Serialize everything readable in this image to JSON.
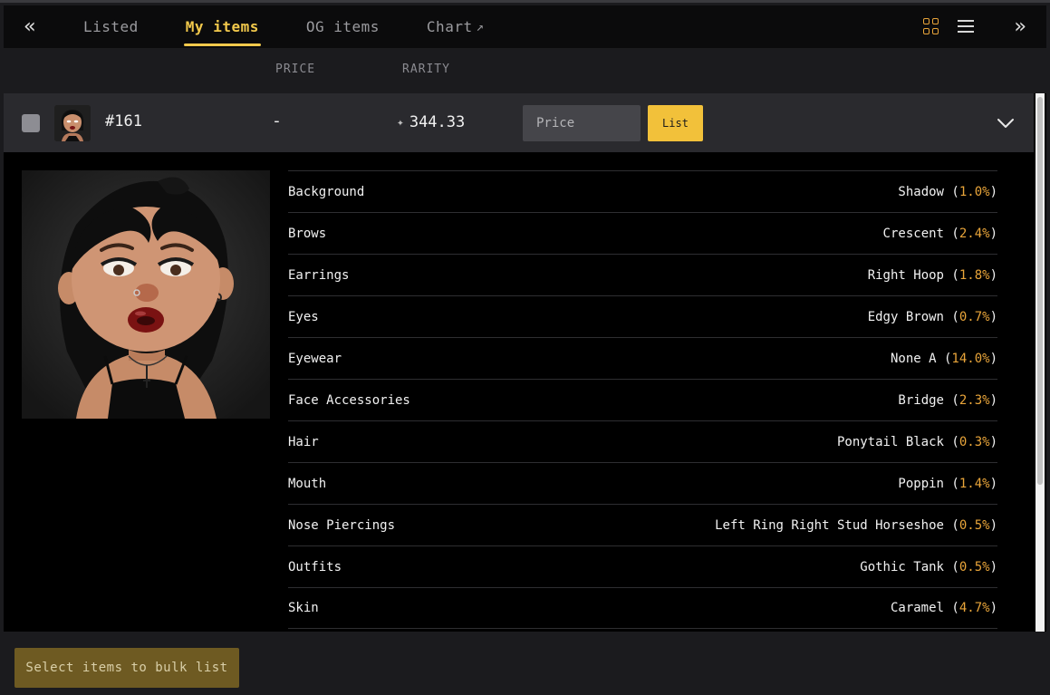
{
  "nav": {
    "collapse_icon": "«",
    "expand_icon": "»",
    "tabs": [
      {
        "label": "Listed",
        "active": false
      },
      {
        "label": "My items",
        "active": true
      },
      {
        "label": "OG items",
        "active": false
      },
      {
        "label": "Chart",
        "active": false,
        "external_icon": "↗"
      }
    ],
    "accent_color": "#f2c94c"
  },
  "columns": {
    "price": "PRICE",
    "rarity": "RARITY"
  },
  "item": {
    "id": "#161",
    "price": "-",
    "rarity_icon": "sparkle-icon",
    "rarity": "344.33",
    "price_placeholder": "Price",
    "list_label": "List",
    "traits": [
      {
        "name": "Background",
        "value": "Shadow",
        "pct": "1.0%"
      },
      {
        "name": "Brows",
        "value": "Crescent",
        "pct": "2.4%"
      },
      {
        "name": "Earrings",
        "value": "Right Hoop",
        "pct": "1.8%"
      },
      {
        "name": "Eyes",
        "value": "Edgy Brown",
        "pct": "0.7%"
      },
      {
        "name": "Eyewear",
        "value": "None A",
        "pct": "14.0%"
      },
      {
        "name": "Face Accessories",
        "value": "Bridge",
        "pct": "2.3%"
      },
      {
        "name": "Hair",
        "value": "Ponytail Black",
        "pct": "0.3%"
      },
      {
        "name": "Mouth",
        "value": "Poppin",
        "pct": "1.4%"
      },
      {
        "name": "Nose Piercings",
        "value": "Left Ring Right Stud Horseshoe",
        "pct": "0.5%"
      },
      {
        "name": "Outfits",
        "value": "Gothic Tank",
        "pct": "0.5%"
      },
      {
        "name": "Skin",
        "value": "Caramel",
        "pct": "4.7%"
      }
    ]
  },
  "footer": {
    "bulk_label": "Select items to bulk list"
  }
}
